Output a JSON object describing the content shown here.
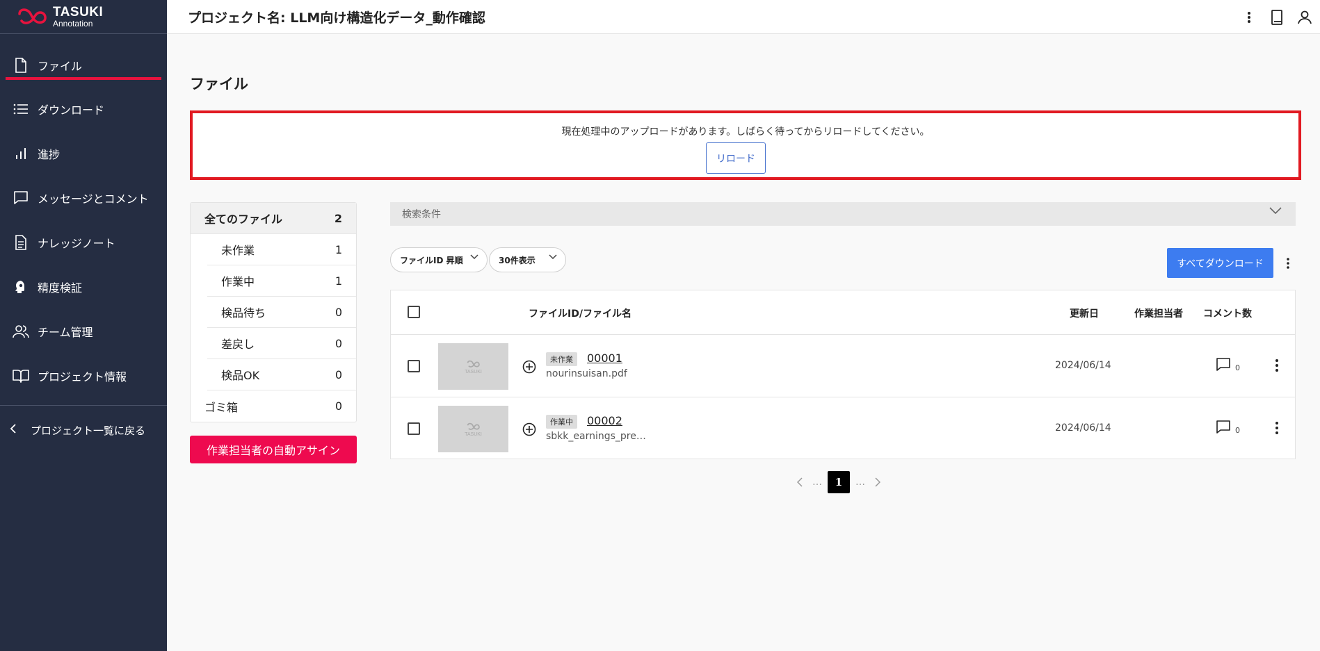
{
  "brand": {
    "name": "TASUKI",
    "sub": "Annotation",
    "accent": "#e8133e"
  },
  "header": {
    "title": "プロジェクト名: LLM向け構造化データ_動作確認"
  },
  "sidebar": {
    "items": [
      {
        "label": "ファイル",
        "icon": "file-icon"
      },
      {
        "label": "ダウンロード",
        "icon": "list-icon"
      },
      {
        "label": "進捗",
        "icon": "bar-chart-icon"
      },
      {
        "label": "メッセージとコメント",
        "icon": "message-icon"
      },
      {
        "label": "ナレッジノート",
        "icon": "document-icon"
      },
      {
        "label": "精度検証",
        "icon": "head-icon"
      },
      {
        "label": "チーム管理",
        "icon": "team-icon"
      },
      {
        "label": "プロジェクト情報",
        "icon": "book-icon"
      }
    ],
    "back_label": "プロジェクト一覧に戻る"
  },
  "page": {
    "title": "ファイル"
  },
  "notice": {
    "message": "現在処理中のアップロードがあります。しばらく待ってからリロードしてください。",
    "reload_label": "リロード"
  },
  "status": {
    "total_label": "全てのファイル",
    "total_count": "2",
    "items": [
      {
        "label": "未作業",
        "count": "1"
      },
      {
        "label": "作業中",
        "count": "1"
      },
      {
        "label": "検品待ち",
        "count": "0"
      },
      {
        "label": "差戻し",
        "count": "0"
      },
      {
        "label": "検品OK",
        "count": "0"
      }
    ],
    "trash_label": "ゴミ箱",
    "trash_count": "0"
  },
  "assign_label": "作業担当者の自動アサイン",
  "search": {
    "label": "検索条件"
  },
  "filters": {
    "sort": "ファイルID 昇順",
    "per_page": "30件表示"
  },
  "download_all_label": "すべてダウンロード",
  "table": {
    "headers": {
      "file": "ファイルID/ファイル名",
      "updated": "更新日",
      "assignee": "作業担当者",
      "comments": "コメント数"
    },
    "rows": [
      {
        "status": "未作業",
        "id": "00001",
        "name": "nourinsuisan.pdf",
        "date": "2024/06/14",
        "comments": "0",
        "thumb_label": "TASUKI"
      },
      {
        "status": "作業中",
        "id": "00002",
        "name": "sbkk_earnings_pre…",
        "date": "2024/06/14",
        "comments": "0",
        "thumb_label": "TASUKI"
      }
    ]
  },
  "pagination": {
    "current": "1",
    "ellipsis": "…"
  }
}
